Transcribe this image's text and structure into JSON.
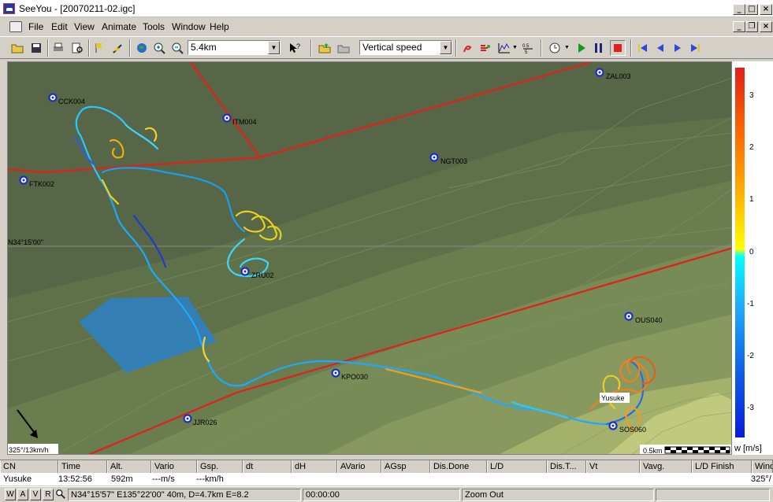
{
  "window": {
    "title": "SeeYou - [20070211-02.igc]"
  },
  "menu": {
    "items": [
      {
        "label": "File",
        "key": "F"
      },
      {
        "label": "Edit",
        "key": "E"
      },
      {
        "label": "View",
        "key": "V"
      },
      {
        "label": "Animate",
        "key": "A"
      },
      {
        "label": "Tools",
        "key": "T"
      },
      {
        "label": "Window",
        "key": "W"
      },
      {
        "label": "Help",
        "key": "H"
      }
    ]
  },
  "toolbar": {
    "zoom_value": "5.4km",
    "display_mode": "Vertical speed",
    "icons": [
      "open-folder-icon",
      "save-icon",
      "print-icon",
      "print-preview-icon",
      "flag-icon",
      "task-edit-icon",
      "globe-icon",
      "zoom-in-icon",
      "zoom-out-icon",
      "help-cursor-icon",
      "import-icon",
      "export-icon",
      "thermal-icon",
      "wind-icon",
      "barogram-icon",
      "statistics-icon",
      "clock-icon",
      "play-icon",
      "pause-icon",
      "stop-icon",
      "rewind-start-icon",
      "step-back-icon",
      "step-forward-icon",
      "forward-end-icon"
    ]
  },
  "map": {
    "latitude_label": "N34°15'00\"",
    "wind_label": "325°/13km/h",
    "scale_label": "0.5km",
    "pilot_label": "Yusuke",
    "waypoints": [
      {
        "name": "CCK004"
      },
      {
        "name": "ITM004"
      },
      {
        "name": "ZAL003"
      },
      {
        "name": "NGT003"
      },
      {
        "name": "FTK002"
      },
      {
        "name": "ZRU02"
      },
      {
        "name": "OUS040"
      },
      {
        "name": "KPO030"
      },
      {
        "name": "JJR026"
      },
      {
        "name": "SOS060"
      }
    ]
  },
  "legend": {
    "ticks": [
      "3",
      "2",
      "1",
      "0",
      "-1",
      "-2",
      "-3"
    ],
    "unit": "w [m/s]",
    "colors": {
      "high": "#e0201a",
      "mid_high": "#ffff00",
      "mid_low": "#00ffff",
      "low": "#0a1ae0"
    }
  },
  "table": {
    "columns": [
      "CN",
      "Time",
      "Alt.",
      "Vario",
      "Gsp.",
      "dt",
      "dH",
      "AVario",
      "AGsp",
      "Dis.Done",
      "L/D",
      "Dis.T...",
      "Vt",
      "Vavg.",
      "L/D Finish",
      "Wind"
    ],
    "row": {
      "cn": "Yusuke",
      "time": "13:52:56",
      "alt": "592m",
      "vario": "---m/s",
      "gsp": "---km/h",
      "wind": "325°/"
    }
  },
  "status": {
    "buttons": [
      "W",
      "A",
      "V",
      "R"
    ],
    "position": "N34°15'57\"  E135°22'00\" 40m, D=4.7km E=8.2",
    "elapsed": "00:00:00",
    "action": "Zoom Out"
  }
}
